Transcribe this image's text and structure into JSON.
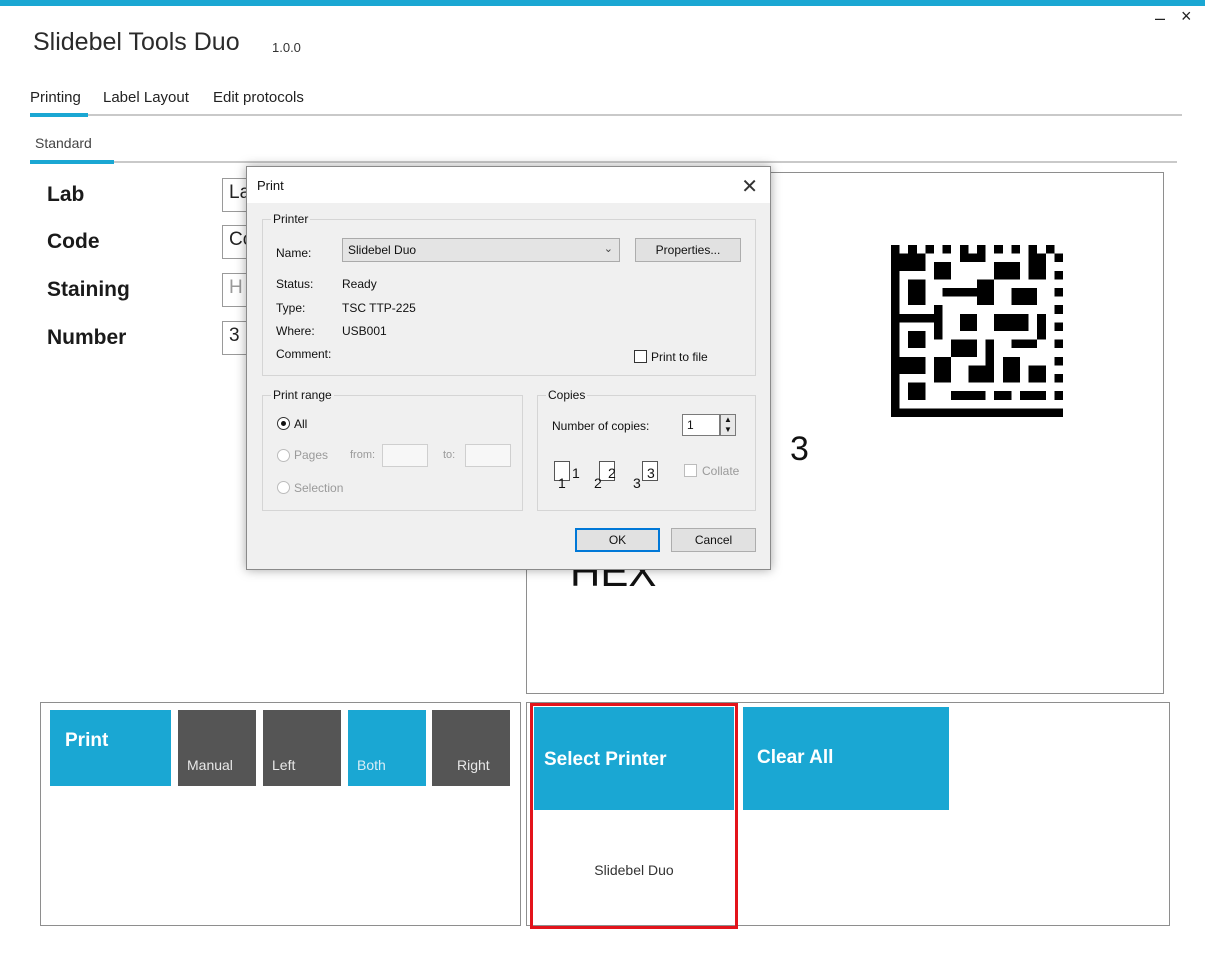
{
  "window": {
    "title": "Slidebel Tools Duo",
    "version": "1.0.0",
    "minimize_glyph": "–",
    "close_glyph": "×"
  },
  "menu": {
    "items": [
      "Printing",
      "Label Layout",
      "Edit protocols"
    ]
  },
  "subtabs": [
    "Standard"
  ],
  "form": {
    "lab_label": "Lab",
    "lab_value": "La",
    "code_label": "Code",
    "code_value": "Cc",
    "staining_label": "Staining",
    "staining_placeholder": "H",
    "number_label": "Number",
    "number_value": "3"
  },
  "preview": {
    "number_text": "3",
    "staining_text": "HEX",
    "datamatrix_icon": "datamatrix-icon"
  },
  "print_panel": {
    "print_label": "Print",
    "modes": [
      "Manual",
      "Left",
      "Both",
      "Right"
    ],
    "active_mode": "Both"
  },
  "printer_panel": {
    "select_label": "Select Printer",
    "clear_label": "Clear All",
    "selected_printer": "Slidebel Duo"
  },
  "dialog": {
    "title": "Print",
    "close_glyph": "✕",
    "printer_group": "Printer",
    "name_label": "Name:",
    "name_value": "Slidebel Duo",
    "properties_label": "Properties...",
    "status_label": "Status:",
    "status_value": "Ready",
    "type_label": "Type:",
    "type_value": "TSC TTP-225",
    "where_label": "Where:",
    "where_value": "USB001",
    "comment_label": "Comment:",
    "print_to_file_label": "Print to file",
    "range_group": "Print range",
    "all_label": "All",
    "pages_label": "Pages",
    "from_label": "from:",
    "to_label": "to:",
    "selection_label": "Selection",
    "copies_group": "Copies",
    "num_copies_label": "Number of copies:",
    "num_copies_value": "1",
    "collate_label": "Collate",
    "collate_pages": [
      "1",
      "2",
      "3"
    ],
    "ok_label": "OK",
    "cancel_label": "Cancel"
  },
  "colors": {
    "accent": "#1aa7d3",
    "dark_tile": "#555555",
    "highlight": "#e3131b"
  }
}
